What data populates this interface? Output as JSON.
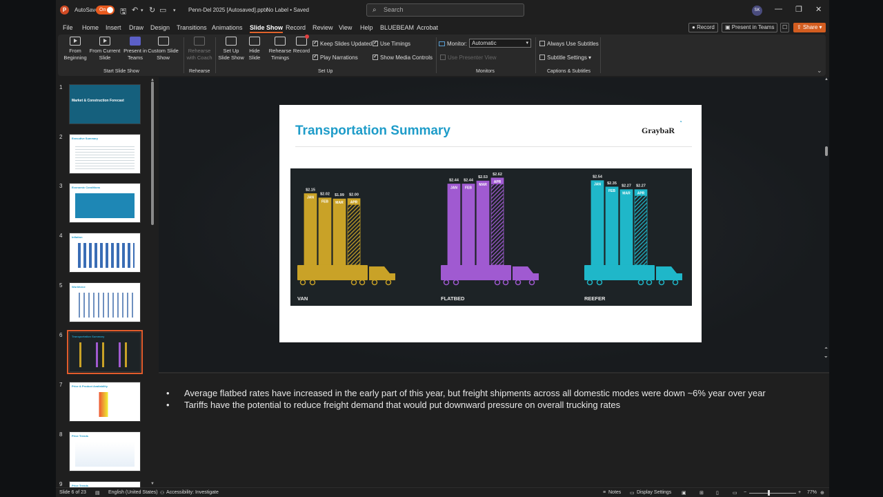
{
  "titlebar": {
    "autosave_label": "AutoSave",
    "autosave_state": "On",
    "doc_title": "Penn-Del 2025 [Autosaved].pptx",
    "label_status": "No Label • Saved",
    "search_placeholder": "Search",
    "avatar_initials": "SK"
  },
  "menu": {
    "tabs": [
      "File",
      "Home",
      "Insert",
      "Draw",
      "Design",
      "Transitions",
      "Animations",
      "Slide Show",
      "Record",
      "Review",
      "View",
      "Help",
      "BLUEBEAM",
      "Acrobat"
    ],
    "record_btn": "Record",
    "present_teams_btn": "Present in Teams",
    "share_btn": "Share"
  },
  "ribbon": {
    "from_beginning": "From Beginning",
    "from_current": "From Current Slide",
    "present_teams": "Present in Teams",
    "custom_show": "Custom Slide Show",
    "group_start": "Start Slide Show",
    "rehearse_coach": "Rehearse with Coach",
    "group_rehearse": "Rehearse",
    "setup_show": "Set Up Slide Show",
    "hide_slide": "Hide Slide",
    "rehearse_timings": "Rehearse Timings",
    "record": "Record",
    "keep_updated": "Keep Slides Updated",
    "play_narrations": "Play Narrations",
    "use_timings": "Use Timings",
    "show_media": "Show Media Controls",
    "group_setup": "Set Up",
    "monitor_label": "Monitor:",
    "monitor_value": "Automatic",
    "presenter_view": "Use Presenter View",
    "group_monitors": "Monitors",
    "always_subtitles": "Always Use Subtitles",
    "subtitle_settings": "Subtitle Settings",
    "group_captions": "Captions & Subtitles"
  },
  "thumbnails": [
    {
      "num": "1",
      "title": "Market & Construction Forecast"
    },
    {
      "num": "2",
      "title": "Executive Summary"
    },
    {
      "num": "3",
      "title": "Economic Conditions"
    },
    {
      "num": "4",
      "title": "Inflation"
    },
    {
      "num": "5",
      "title": "Workforce"
    },
    {
      "num": "6",
      "title": "Transportation Summary"
    },
    {
      "num": "7",
      "title": "Price & Product Availability"
    },
    {
      "num": "8",
      "title": "Price Trends"
    },
    {
      "num": "9",
      "title": "Price Trends"
    }
  ],
  "slide": {
    "title": "Transportation Summary",
    "logo": "GraybaR"
  },
  "chart_data": {
    "type": "bar",
    "categories": [
      "JAN",
      "FEB",
      "MAR",
      "APR"
    ],
    "series": [
      {
        "name": "VAN",
        "values": [
          2.15,
          2.02,
          1.99,
          2.0
        ],
        "labels": [
          "$2.15",
          "$2.02",
          "$1.99",
          "$2.00"
        ],
        "color": "#c9a227"
      },
      {
        "name": "FLATBED",
        "values": [
          2.44,
          2.44,
          2.53,
          2.62
        ],
        "labels": [
          "$2.44",
          "$2.44",
          "$2.53",
          "$2.62"
        ],
        "color": "#a05ad1"
      },
      {
        "name": "REEFER",
        "values": [
          2.54,
          2.35,
          2.27,
          2.27
        ],
        "labels": [
          "$2.54",
          "$2.35",
          "$2.27",
          "$2.27"
        ],
        "color": "#1fb7c9"
      }
    ],
    "background": "#1d2326"
  },
  "notes": [
    "Average flatbed rates have increased in the early part of this year, but freight shipments across all domestic modes were down ~6% year over year",
    "Tariffs have the potential to reduce freight demand that would put downward pressure on overall trucking rates"
  ],
  "status": {
    "slide_count": "Slide 6 of 23",
    "language": "English (United States)",
    "accessibility": "Accessibility: Investigate",
    "notes": "Notes",
    "display_settings": "Display Settings",
    "zoom": "77%"
  }
}
